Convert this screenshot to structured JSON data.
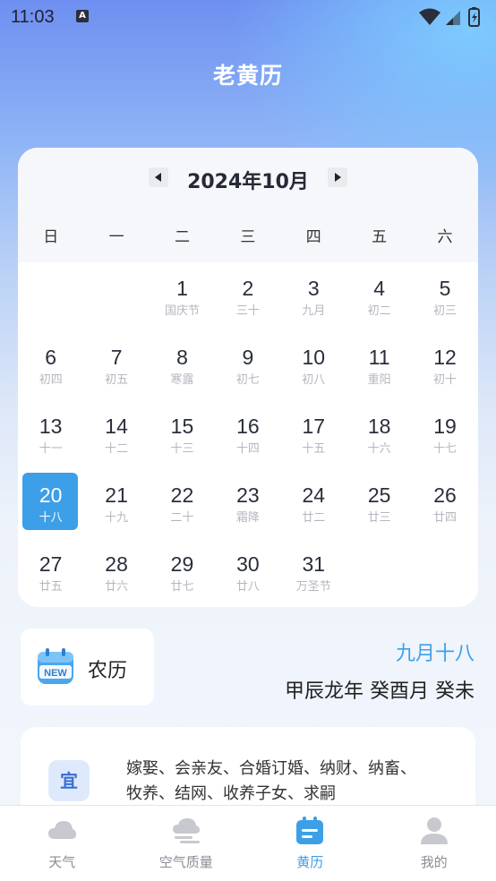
{
  "status_bar": {
    "time": "11:03",
    "notification_icon_letter": "A"
  },
  "header": {
    "title": "老黄历"
  },
  "calendar": {
    "month_label": "2024年10月",
    "weekdays": [
      "日",
      "一",
      "二",
      "三",
      "四",
      "五",
      "六"
    ],
    "days": [
      {
        "num": "",
        "lunar": ""
      },
      {
        "num": "",
        "lunar": ""
      },
      {
        "num": "1",
        "lunar": "国庆节"
      },
      {
        "num": "2",
        "lunar": "三十"
      },
      {
        "num": "3",
        "lunar": "九月"
      },
      {
        "num": "4",
        "lunar": "初二"
      },
      {
        "num": "5",
        "lunar": "初三"
      },
      {
        "num": "6",
        "lunar": "初四"
      },
      {
        "num": "7",
        "lunar": "初五"
      },
      {
        "num": "8",
        "lunar": "寒露"
      },
      {
        "num": "9",
        "lunar": "初七"
      },
      {
        "num": "10",
        "lunar": "初八"
      },
      {
        "num": "11",
        "lunar": "重阳"
      },
      {
        "num": "12",
        "lunar": "初十"
      },
      {
        "num": "13",
        "lunar": "十一"
      },
      {
        "num": "14",
        "lunar": "十二"
      },
      {
        "num": "15",
        "lunar": "十三"
      },
      {
        "num": "16",
        "lunar": "十四"
      },
      {
        "num": "17",
        "lunar": "十五"
      },
      {
        "num": "18",
        "lunar": "十六"
      },
      {
        "num": "19",
        "lunar": "十七"
      },
      {
        "num": "20",
        "lunar": "十八",
        "selected": true
      },
      {
        "num": "21",
        "lunar": "十九"
      },
      {
        "num": "22",
        "lunar": "二十"
      },
      {
        "num": "23",
        "lunar": "霜降"
      },
      {
        "num": "24",
        "lunar": "廿二"
      },
      {
        "num": "25",
        "lunar": "廿三"
      },
      {
        "num": "26",
        "lunar": "廿四"
      },
      {
        "num": "27",
        "lunar": "廿五"
      },
      {
        "num": "28",
        "lunar": "廿六"
      },
      {
        "num": "29",
        "lunar": "廿七"
      },
      {
        "num": "30",
        "lunar": "廿八"
      },
      {
        "num": "31",
        "lunar": "万圣节"
      }
    ],
    "selected_color": "#3d9fe8"
  },
  "lunar_info": {
    "badge_label": "农历",
    "badge_icon_text": "NEW",
    "lunar_date": "九月十八",
    "ganzhi": "甲辰龙年 癸酉月 癸未"
  },
  "yi": {
    "icon_label": "宜",
    "text": "嫁娶、会亲友、合婚订婚、纳财、纳畜、牧养、结网、收养子女、求嗣"
  },
  "bottom_nav": {
    "items": [
      {
        "label": "天气",
        "icon": "cloud-icon"
      },
      {
        "label": "空气质量",
        "icon": "air-quality-icon"
      },
      {
        "label": "黄历",
        "icon": "calendar-icon",
        "active": true
      },
      {
        "label": "我的",
        "icon": "profile-icon"
      }
    ],
    "active_color": "#3da0e7"
  }
}
